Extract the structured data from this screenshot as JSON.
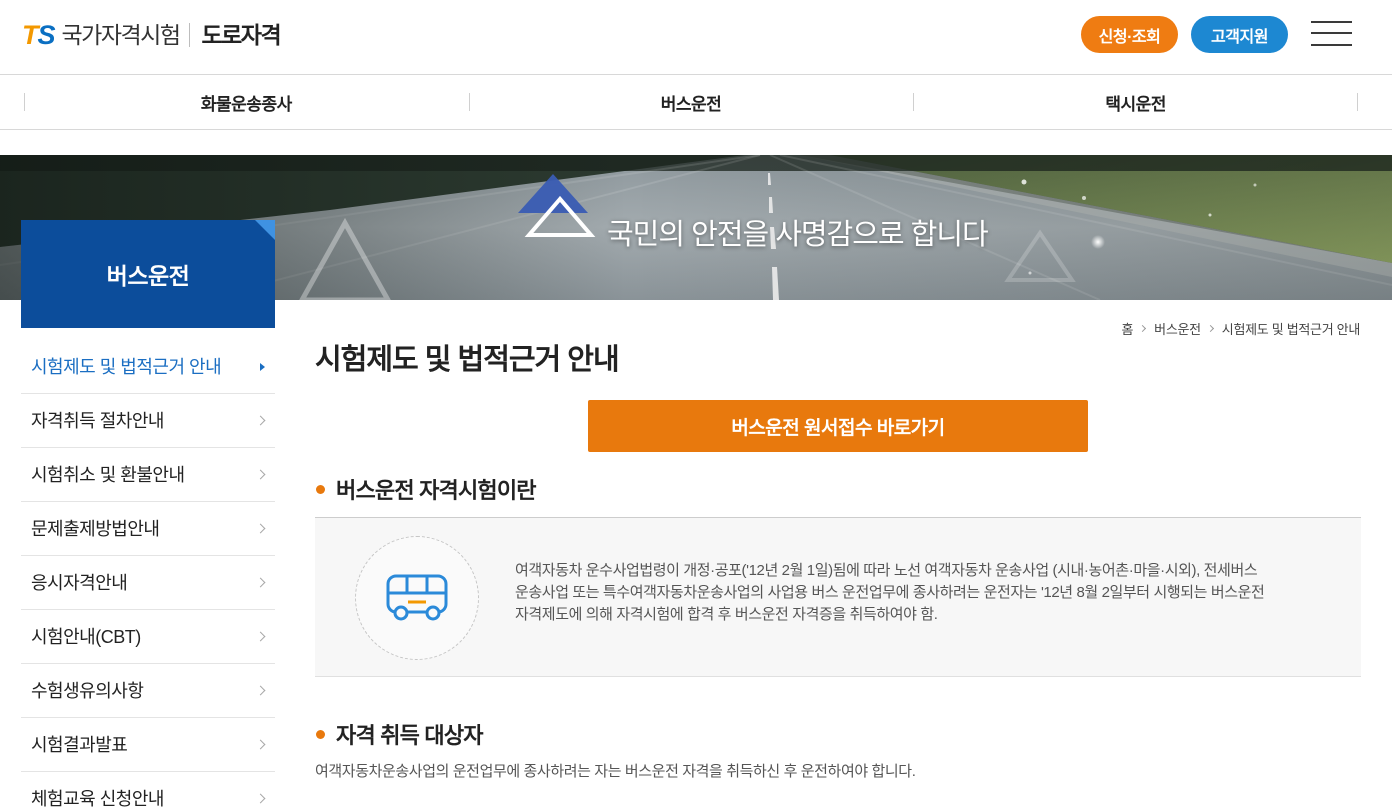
{
  "header": {
    "logo": {
      "mark_t": "T",
      "mark_s": "S",
      "org_name": "국가자격시험",
      "site_name": "도로자격"
    },
    "apply_button": "신청·조회",
    "support_button": "고객지원",
    "menu_icon": "hamburger-menu-icon"
  },
  "gnb": [
    {
      "label": "화물운송종사"
    },
    {
      "label": "버스운전"
    },
    {
      "label": "택시운전"
    }
  ],
  "banner": {
    "slogan": "국민의 안전을 사명감으로 합니다",
    "logo_icon": "triangle-logo-icon"
  },
  "sidebar": {
    "title": "버스운전",
    "item_icon": "chevron-right-icon",
    "items": [
      {
        "label": "시험제도 및 법적근거 안내",
        "active": true
      },
      {
        "label": "자격취득 절차안내"
      },
      {
        "label": "시험취소 및 환불안내"
      },
      {
        "label": "문제출제방법안내"
      },
      {
        "label": "응시자격안내"
      },
      {
        "label": "시험안내(CBT)"
      },
      {
        "label": "수험생유의사항"
      },
      {
        "label": "시험결과발표"
      },
      {
        "label": "체험교육 신청안내"
      }
    ]
  },
  "breadcrumb": [
    "홈",
    "버스운전",
    "시험제도 및 법적근거 안내"
  ],
  "page_title": "시험제도 및 법적근거 안내",
  "cta_button": "버스운전 원서접수 바로가기",
  "sections": [
    {
      "title": "버스운전 자격시험이란",
      "icon": "bus-icon",
      "description_lines": [
        "여객자동차 운수사업법령이 개정·공포('12년 2월 1일)됨에 따라 노선 여객자동차 운송사업 (시내·농어촌·마을·시외), 전세버스",
        "운송사업 또는 특수여객자동차운송사업의 사업용 버스 운전업무에 종사하려는 운전자는 '12년 8월 2일부터 시행되는 버스운전",
        "자격제도에 의해 자격시험에 합격 후 버스운전 자격증을 취득하여야 함."
      ]
    },
    {
      "title": "자격 취득 대상자",
      "text": "여객자동차운송사업의 운전업무에 종사하려는 자는 버스운전 자격을 취득하신 후 운전하여야 합니다."
    }
  ],
  "colors": {
    "brand_orange": "#e8790d",
    "pill_orange": "#ef7c12",
    "brand_blue": "#0c4d9b",
    "support_blue": "#1d88d2",
    "active_link": "#1b6ec2",
    "logo_t": "#f39800",
    "logo_s": "#0a6fc2"
  }
}
